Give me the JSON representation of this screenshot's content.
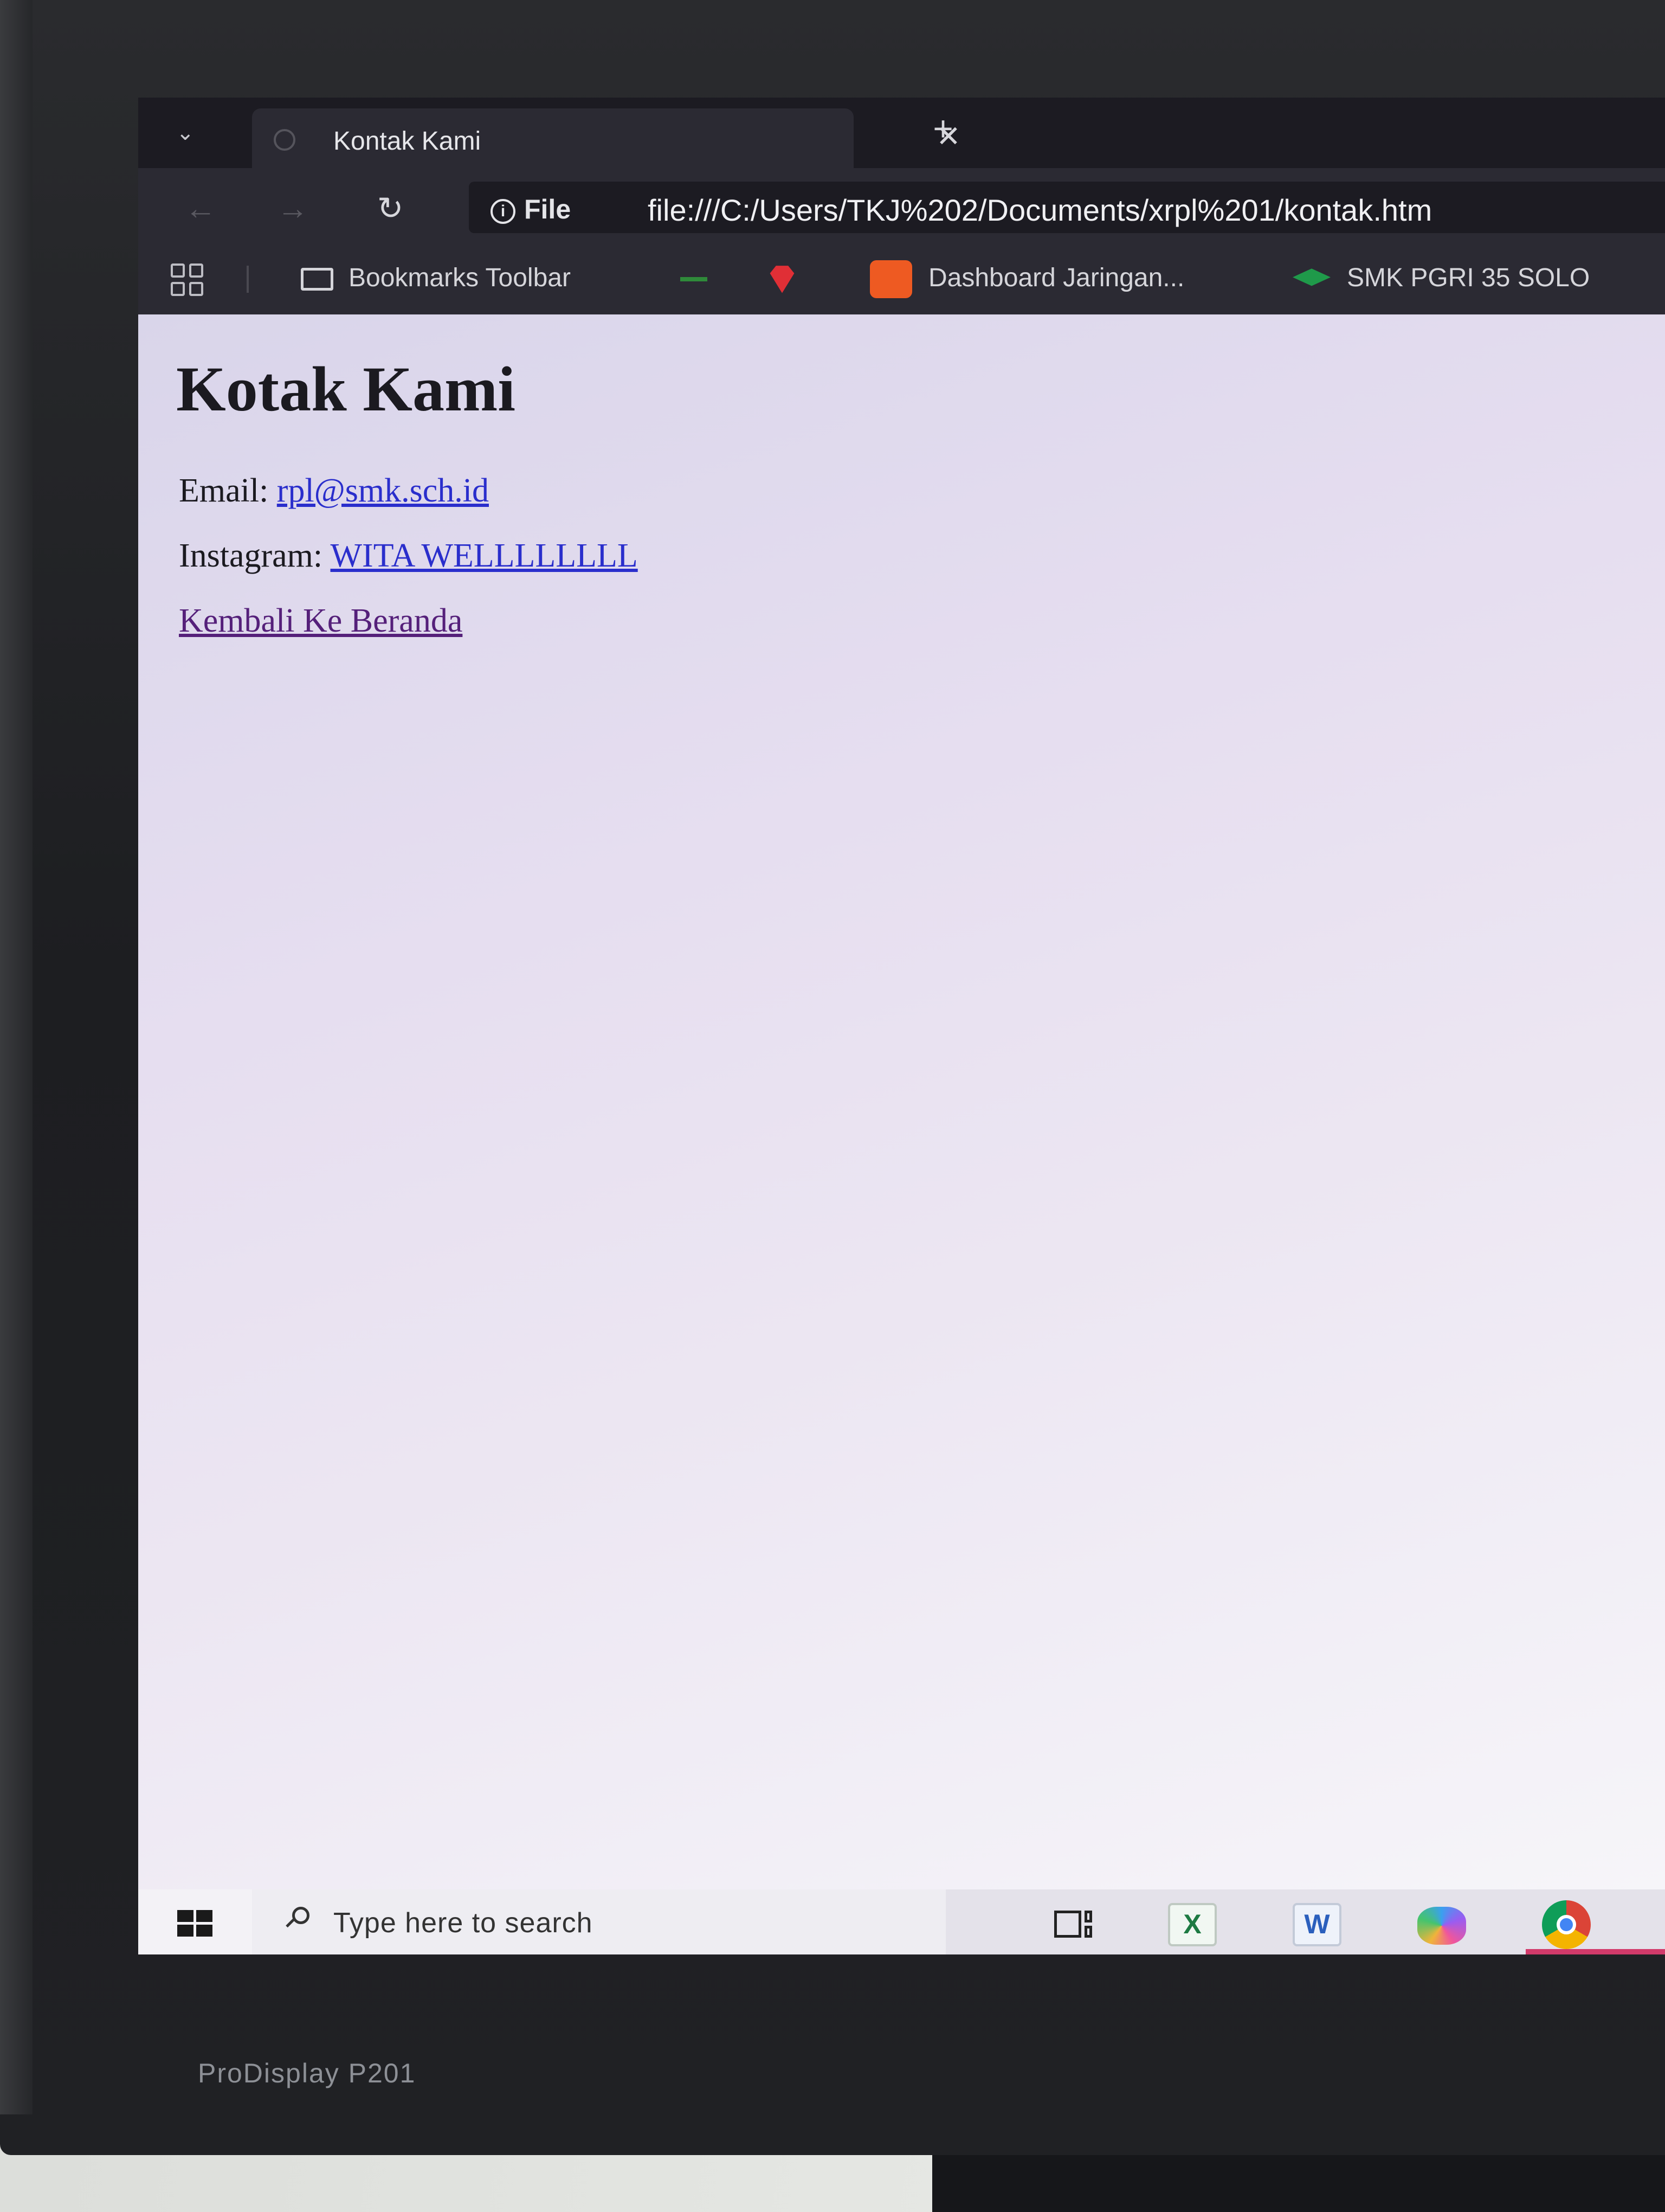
{
  "browser": {
    "tab": {
      "title": "Kontak Kami"
    },
    "address": {
      "site_info": "File",
      "url": "file:///C:/Users/TKJ%202/Documents/xrpl%201/kontak.htm"
    },
    "bookmarks": [
      {
        "label": "Bookmarks Toolbar",
        "icon": "folder-icon"
      },
      {
        "label": "",
        "icon": "green-dash-icon"
      },
      {
        "label": "",
        "icon": "gem-icon"
      },
      {
        "label": "Dashboard Jaringan...",
        "icon": "dashboard-favicon"
      },
      {
        "label": "SMK PGRI 35 SOLO",
        "icon": "graduation-cap-icon"
      }
    ]
  },
  "page": {
    "heading": "Kotak Kami",
    "email": {
      "label": "Email:",
      "link": "rpl@smk.sch.id"
    },
    "instagram": {
      "label": "Instagram:",
      "link": "WITA WELLLLLLLL"
    },
    "back_link": "Kembali Ke Beranda"
  },
  "taskbar": {
    "search_placeholder": "Type here to search",
    "apps": [
      "task-view-icon",
      "excel-icon",
      "word-icon",
      "copilot-icon",
      "chrome-icon"
    ],
    "excel_glyph": "X",
    "word_glyph": "W"
  },
  "monitor": {
    "brand": "ProDisplay P201"
  },
  "colors": {
    "link": "#2a2ecc",
    "visited_link": "#55207a",
    "chrome_dark": "#2b2a33"
  }
}
